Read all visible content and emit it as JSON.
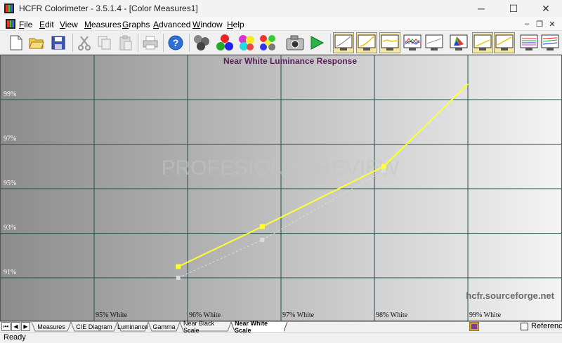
{
  "window": {
    "title": "HCFR Colorimeter - 3.5.1.4 - [Color Measures1]",
    "minimize": "─",
    "maximize": "☐",
    "close": "✕"
  },
  "menu": {
    "items": [
      {
        "label": "File",
        "ul": "F",
        "rest": "ile"
      },
      {
        "label": "Edit",
        "ul": "E",
        "rest": "dit"
      },
      {
        "label": "View",
        "ul": "V",
        "rest": "iew"
      },
      {
        "label": "Measures",
        "ul": "M",
        "rest": "easures"
      },
      {
        "label": "Graphs",
        "ul": "G",
        "rest": "raphs"
      },
      {
        "label": "Advanced",
        "ul": "A",
        "rest": "dvanced"
      },
      {
        "label": "Window",
        "ul": "W",
        "rest": "indow"
      },
      {
        "label": "Help",
        "ul": "H",
        "rest": "elp"
      }
    ],
    "mdi_minimize": "–",
    "mdi_restore": "❐",
    "mdi_close": "✕"
  },
  "toolbar": {
    "buttons": [
      "new-icon",
      "open-icon",
      "save-icon",
      "cut-icon",
      "copy-icon",
      "paste-icon",
      "print-icon",
      "help-icon",
      "measure-grayscale-icon",
      "measure-primaries-icon",
      "measure-secondaries-icon",
      "measure-all-icon",
      "camera-icon",
      "play-icon",
      "graph-luminance-icon",
      "graph-gamma-icon",
      "graph-rgb-icon",
      "graph-color-temp-icon",
      "graph-deltae-icon",
      "graph-cie-icon",
      "graph-near-black-icon",
      "graph-near-white-icon",
      "graph-saturation-icon",
      "graph-sat-luminance-icon"
    ]
  },
  "chart_data": {
    "type": "line",
    "title": "Near White Luminance Response",
    "watermark": "hcfr.sourceforge.net",
    "logo": "PROFESIONAL REVIEW",
    "x": [
      "95% White",
      "96% White",
      "97% White",
      "98% White",
      "99% White"
    ],
    "y_tick_labels": [
      "91%",
      "93%",
      "95%",
      "97%",
      "99%"
    ],
    "ylim": [
      90.0,
      100.0
    ],
    "series": [
      {
        "name": "",
        "color": "#ffff33",
        "x_pos": [
          0.9,
          1.8,
          3.1,
          4.0
        ],
        "values": [
          91.5,
          93.3,
          96.0,
          99.7
        ]
      },
      {
        "name": "",
        "color": "#dddddd",
        "x_pos": [
          0.9,
          1.8,
          3.1
        ],
        "values": [
          91.0,
          92.7,
          95.8
        ]
      }
    ],
    "grid": true,
    "x_tick_label_color": "#111111",
    "y_tick_label_color": "#ffffff",
    "title_color": "#5a1f5a"
  },
  "tabs": {
    "items": [
      "Measures",
      "CIE Diagram",
      "Luminance",
      "Gamma",
      "Near Black Scale",
      "Near White Scale"
    ],
    "active": "Near White Scale",
    "nav": [
      "⏮",
      "◀",
      "▶"
    ]
  },
  "status": {
    "text": "Ready",
    "reference_label": "Reference"
  }
}
